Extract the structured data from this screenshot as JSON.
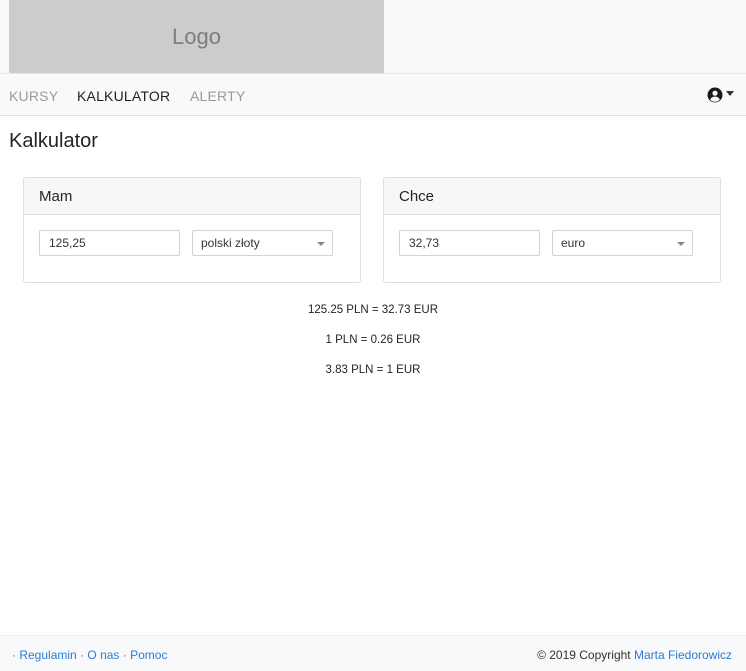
{
  "header": {
    "logo_text": "Logo"
  },
  "nav": {
    "items": [
      {
        "label": "KURSY",
        "active": false
      },
      {
        "label": "KALKULATOR",
        "active": true
      },
      {
        "label": "ALERTY",
        "active": false
      }
    ],
    "user_icon": "user-circle-icon"
  },
  "page": {
    "title": "Kalkulator"
  },
  "have": {
    "title": "Mam",
    "amount": "125,25",
    "currency": "polski złoty"
  },
  "want": {
    "title": "Chce",
    "amount": "32,73",
    "currency": "euro"
  },
  "results": [
    "125.25 PLN = 32.73 EUR",
    "1 PLN = 0.26 EUR",
    "3.83 PLN = 1 EUR"
  ],
  "footer": {
    "sep": "·",
    "links": [
      "Regulamin",
      "O nas",
      "Pomoc"
    ],
    "copyright_prefix": "© 2019 Copyright",
    "author": "Marta Fiedorowicz"
  },
  "colors": {
    "link": "#2e7bd6",
    "logo_bg": "#cccccc",
    "nav_bg": "#f8f9fa"
  }
}
